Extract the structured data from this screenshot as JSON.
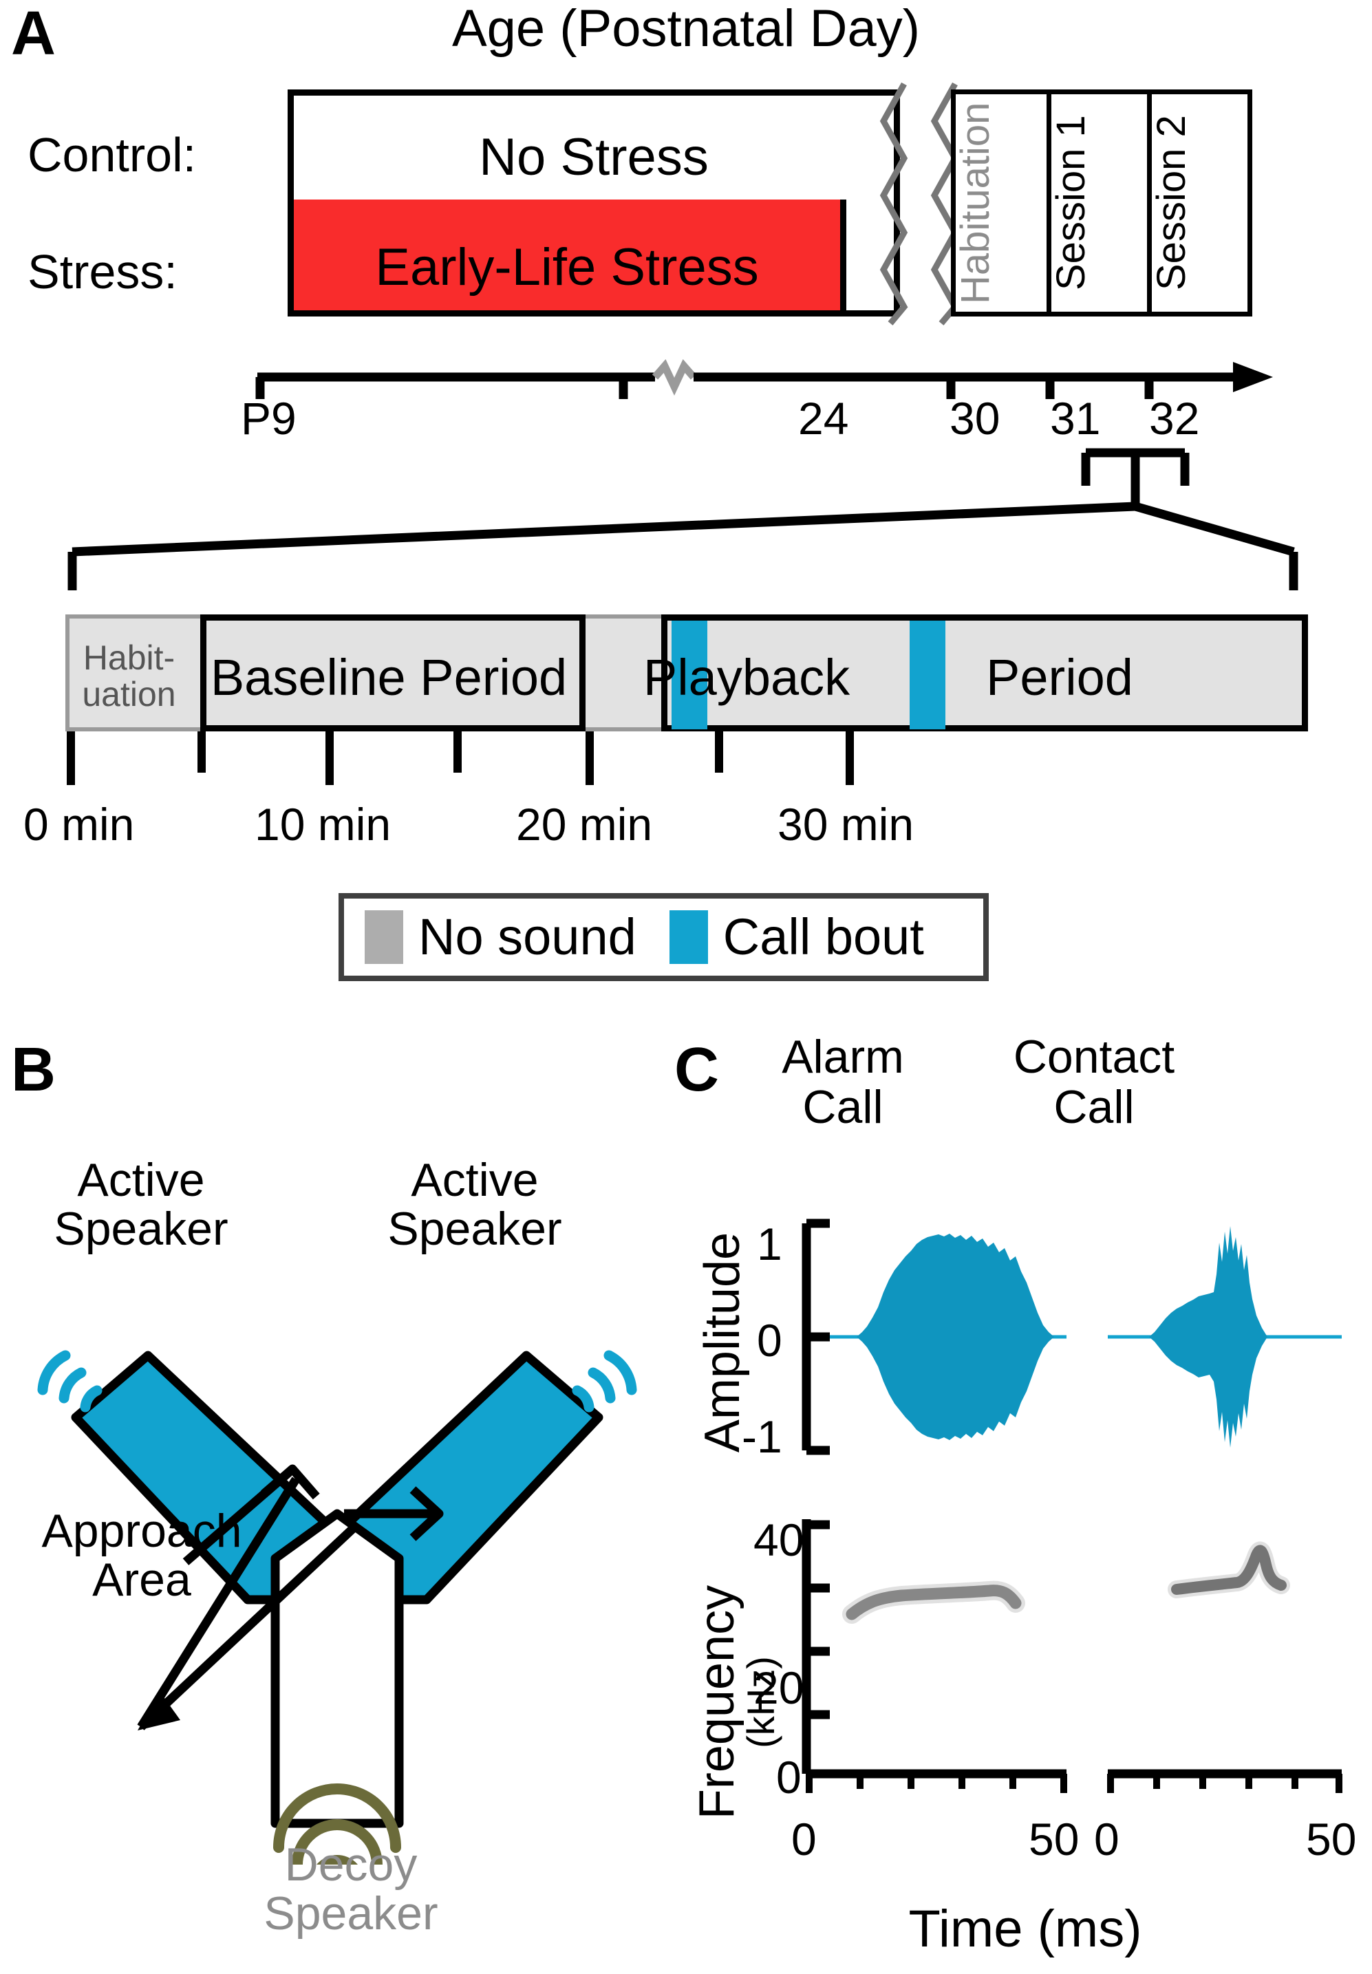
{
  "figure": {
    "panels": [
      "A",
      "B",
      "C"
    ]
  },
  "panelA": {
    "letter": "A",
    "title": "Age (Postnatal Day)",
    "group_labels": {
      "control": "Control:",
      "stress": "Stress:"
    },
    "bars": {
      "control": "No Stress",
      "stress": "Early-Life Stress"
    },
    "session_boxes": [
      {
        "label": "Habituation",
        "color": "#8c8c8c"
      },
      {
        "label": "Session 1",
        "color": "#000000"
      },
      {
        "label": "Session 2",
        "color": "#000000"
      }
    ],
    "axis_ticks": [
      "P9",
      "24",
      "30",
      "31",
      "32"
    ],
    "session_timeline": {
      "habituation": "Habit-\nuation",
      "habituation_line1": "Habit-",
      "habituation_line2": "uation",
      "baseline": "Baseline Period",
      "playback": "Playback",
      "period": "Period",
      "time_ticks": [
        "0 min",
        "10 min",
        "20 min",
        "30 min"
      ]
    },
    "legend": [
      {
        "label": "No sound",
        "color": "#adadad"
      },
      {
        "label": "Call bout",
        "color": "#12a3cf"
      }
    ]
  },
  "panelB": {
    "letter": "B",
    "speaker_left": "Active\nSpeaker",
    "speaker_left_l1": "Active",
    "speaker_left_l2": "Speaker",
    "speaker_right_l1": "Active",
    "speaker_right_l2": "Speaker",
    "approach_l1": "Approach",
    "approach_l2": "Area",
    "decoy_l1": "Decoy",
    "decoy_l2": "Speaker",
    "colors": {
      "arm_active": "#12a3cf",
      "arm_decoy": "#ffffff",
      "wave_active": "#12a3cf",
      "wave_decoy": "#6b6b3a",
      "decoy_text": "#8c8c8c"
    }
  },
  "panelC": {
    "letter": "C",
    "column_headers": [
      {
        "l1": "Alarm",
        "l2": "Call"
      },
      {
        "l1": "Contact",
        "l2": "Call"
      }
    ],
    "amplitude_axis_label": "Amplitude",
    "amplitude_ticks": [
      "1",
      "0",
      "-1"
    ],
    "frequency_axis_label": "Frequency",
    "frequency_axis_units": "(kHz)",
    "frequency_ticks": [
      "40",
      "20",
      "0"
    ],
    "time_axis_label": "Time (ms)",
    "time_ticks_left": [
      "0",
      "50"
    ],
    "time_ticks_right": [
      "0",
      "50"
    ],
    "waveform_color": "#12a3cf"
  },
  "chart_data": [
    {
      "type": "line",
      "title": "Alarm Call waveform",
      "xlabel": "Time (ms)",
      "ylabel": "Amplitude",
      "xlim": [
        0,
        50
      ],
      "ylim": [
        -1,
        1
      ],
      "yticks": [
        1,
        0,
        -1
      ],
      "xticks": [
        0,
        10,
        20,
        30,
        40,
        50
      ],
      "envelope_ms": [
        8,
        10,
        13,
        16,
        19,
        22,
        25,
        28,
        31,
        34,
        37,
        39,
        41
      ],
      "envelope_amp": [
        0.05,
        0.25,
        0.55,
        0.78,
        0.88,
        0.92,
        0.93,
        0.9,
        0.85,
        0.74,
        0.5,
        0.2,
        0.04
      ],
      "grid": false,
      "legend": "none"
    },
    {
      "type": "line",
      "title": "Contact Call waveform",
      "xlabel": "Time (ms)",
      "ylabel": "Amplitude",
      "xlim": [
        0,
        50
      ],
      "ylim": [
        -1,
        1
      ],
      "yticks": [
        1,
        0,
        -1
      ],
      "xticks": [
        0,
        10,
        20,
        30,
        40,
        50
      ],
      "envelope_ms": [
        14,
        17,
        20,
        23,
        26,
        28,
        30,
        31,
        32,
        33,
        35,
        36
      ],
      "envelope_amp": [
        0.05,
        0.22,
        0.38,
        0.48,
        0.55,
        0.58,
        0.7,
        1.0,
        0.95,
        0.8,
        0.35,
        0.04
      ],
      "grid": false,
      "legend": "none"
    },
    {
      "type": "heatmap",
      "title": "Alarm Call spectrogram",
      "xlabel": "Time (ms)",
      "ylabel": "Frequency (kHz)",
      "xlim": [
        0,
        50
      ],
      "ylim": [
        0,
        42
      ],
      "yticks": [
        0,
        10,
        20,
        30,
        40
      ],
      "xticks": [
        0,
        10,
        20,
        30,
        40,
        50
      ],
      "trace_time_ms": [
        9,
        12,
        15,
        19,
        23,
        27,
        31,
        34,
        36,
        38,
        40
      ],
      "trace_freq_khz": [
        25.5,
        26.8,
        27.3,
        27.6,
        27.7,
        27.8,
        28.0,
        28.3,
        28.0,
        27.3,
        26.6
      ],
      "grid": false
    },
    {
      "type": "heatmap",
      "title": "Contact Call spectrogram",
      "xlabel": "Time (ms)",
      "ylabel": "Frequency (kHz)",
      "xlim": [
        0,
        50
      ],
      "ylim": [
        0,
        42
      ],
      "yticks": [
        0,
        10,
        20,
        30,
        40
      ],
      "xticks": [
        0,
        10,
        20,
        30,
        40,
        50
      ],
      "trace_time_ms": [
        16,
        20,
        24,
        27,
        29,
        31,
        32,
        33,
        34,
        36
      ],
      "trace_freq_khz": [
        28.6,
        28.9,
        29.1,
        29.4,
        30.5,
        32.8,
        34.5,
        33.0,
        30.2,
        29.5
      ],
      "grid": false
    }
  ]
}
